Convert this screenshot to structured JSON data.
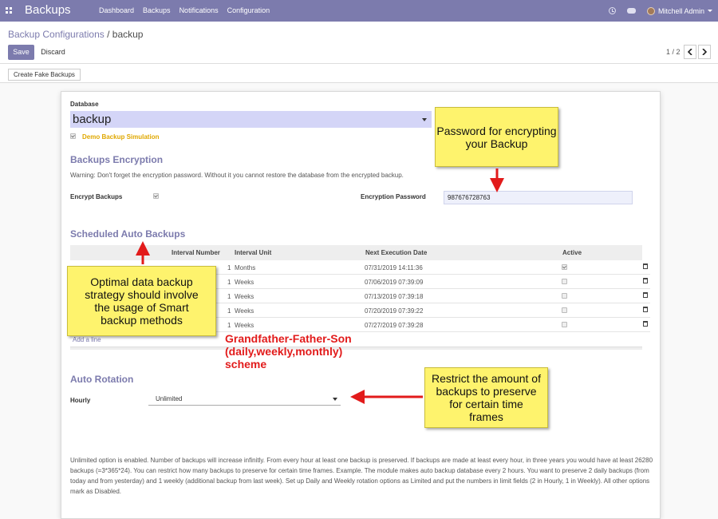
{
  "navbar": {
    "brand": "Backups",
    "menu": [
      "Dashboard",
      "Backups",
      "Notifications",
      "Configuration"
    ],
    "user": "Mitchell Admin"
  },
  "breadcrumb": {
    "parent": "Backup Configurations",
    "separator": " / ",
    "current": "backup"
  },
  "buttons": {
    "save": "Save",
    "discard": "Discard",
    "fake_backups": "Create Fake Backups"
  },
  "pager": {
    "text": "1 / 2"
  },
  "form": {
    "database_label": "Database",
    "database_value": "backup",
    "demo_label": "Demo Backup Simulation",
    "encryption_title": "Backups Encryption",
    "encryption_warning": "Warning: Don't forget the encryption password. Without it you cannot restore the database from the encrypted backup.",
    "encrypt_label": "Encrypt Backups",
    "password_label": "Encryption Password",
    "password_value": "987676728763",
    "scheduled_title": "Scheduled Auto Backups",
    "columns": [
      "Interval Number",
      "Interval Unit",
      "Next Execution Date",
      "Active"
    ],
    "rows": [
      {
        "number": "1",
        "unit": "Months",
        "date": "07/31/2019 14:11:36",
        "active": true
      },
      {
        "number": "1",
        "unit": "Weeks",
        "date": "07/06/2019 07:39:09",
        "active": false
      },
      {
        "number": "1",
        "unit": "Weeks",
        "date": "07/13/2019 07:39:18",
        "active": false
      },
      {
        "number": "1",
        "unit": "Weeks",
        "date": "07/20/2019 07:39:22",
        "active": false
      },
      {
        "number": "1",
        "unit": "Weeks",
        "date": "07/27/2019 07:39:28",
        "active": false
      }
    ],
    "add_line": "Add a line",
    "rotation_title": "Auto Rotation",
    "hourly_label": "Hourly",
    "hourly_value": "Unlimited",
    "help_text": "Unlimited option is enabled. Number of backups will increase infinitly. From every hour at least one backup is preserved. If backups are made at least every hour, in three years you would have at least 26280 backups (=3*365*24). You can restrict how many backups to preserve for certain time frames. Example. The module makes auto backup database every 2 hours. You want to preserve 2 daily backups (from today and from yesterday) and 1 weekly (additional backup from last week). Set up Daily and Weekly rotation options as Limited and put the numbers in limit fields (2 in Hourly, 1 in Weekly). All other options mark as Disabled."
  },
  "annotations": {
    "password_note": "Password for encrypting your Backup",
    "strategy_note": "Optimal data backup strategy should involve the usage of Smart backup methods",
    "gfs_note": "Grandfather-Father-Son (daily,weekly,monthly) scheme",
    "rotation_note": "Restrict the amount of backups to preserve for certain time frames"
  },
  "colors": {
    "brand": "#7c7bad",
    "note_bg": "#fef36d",
    "arrow": "#e21b1b"
  }
}
